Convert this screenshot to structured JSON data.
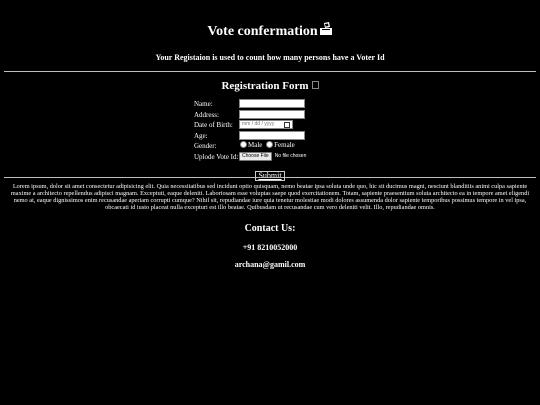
{
  "header": {
    "title": "Vote confermation",
    "title_icon": "ballot-box-icon",
    "subtitle": "Your Registaion is used to count how many persons have a Voter Id"
  },
  "form": {
    "title": "Registration Form",
    "title_icon": "empty-glyph-box",
    "fields": {
      "name_label": "Name:",
      "name_value": "",
      "address_label": "Address:",
      "address_value": "",
      "dob_label": "Date of Birth:",
      "dob_placeholder": "mm / dd / yyyy",
      "age_label": "Age:",
      "age_value": "",
      "gender_label": "Gender:",
      "gender_options": [
        "Male",
        "Female"
      ],
      "upload_label": "Uplode Vote Id:",
      "file_button": "Choose File",
      "file_status": "No file chosen"
    },
    "submit_label": "Submit"
  },
  "body_text": "Lorem ipsum, dolor sit amet consectetur adipisicing elit. Quia necessitatibus sed incidunt optio quisquam, nemo beatae ipsa soluta unde quo, hic sit ducimus magni, nesciunt blanditiis animi culpa sapiente maxime a architecto repellendus adipisci magnam. Exceptuti, eaque deleniti. Laboriosam esse voluptas saepe quod exercitationem. Totam, sapiente praesentium soluta architecto ea in tempore amet eligendi nemo at, eaque dignissimos enim recusandae aperiam corrupti cumque? Nihil sit, repudiandae iure quia tenetur molestiae modi dolores assumenda dolor sapiente temporibus possimus tempore in vel ipsa, obcaecati id iusto placeat nulla excepturi est illo beatae. Quibusdam ut recusandae cum vero deleniti velit. Illo, repudiandae omnis.",
  "contact": {
    "title": "Contact Us:",
    "phone": "+91 8210052000",
    "email": "archana@gamil.com"
  },
  "colors": {
    "background": "#000000",
    "text": "#ffffff",
    "divider": "#bdbdbd"
  }
}
